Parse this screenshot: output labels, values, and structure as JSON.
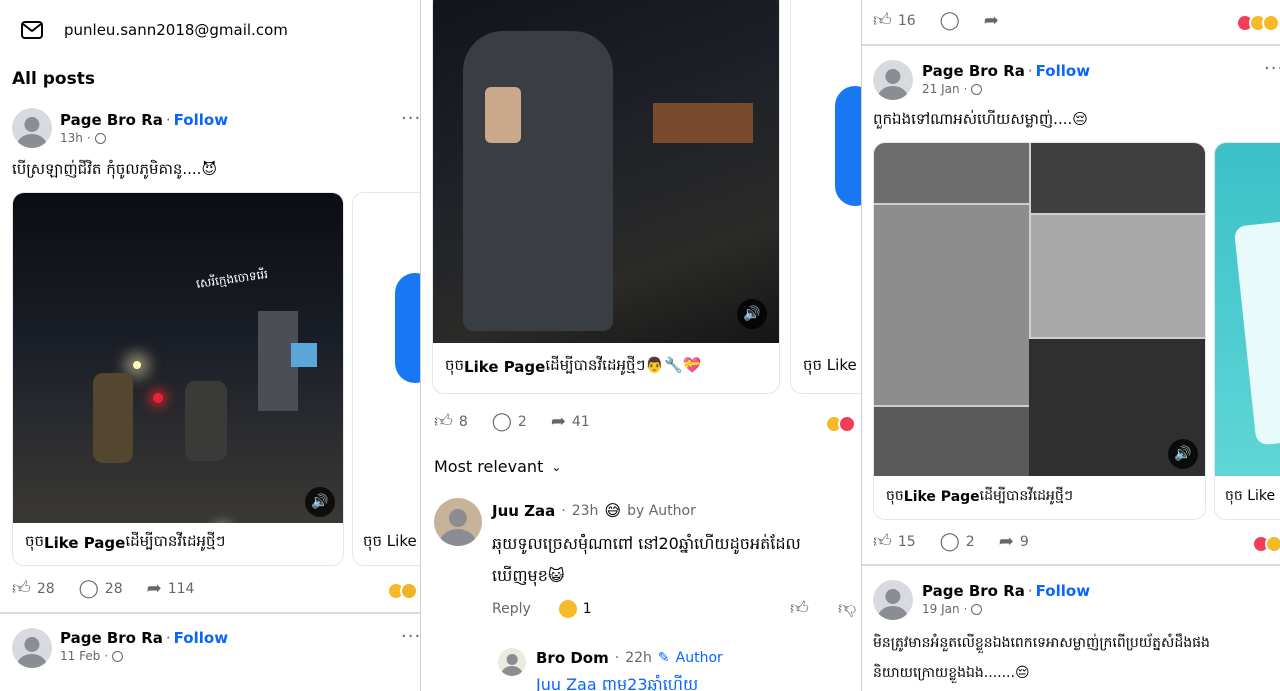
{
  "panel1": {
    "email": "punleu.sann2018@gmail.com",
    "section_title": "All posts",
    "post1": {
      "page_name": "Page Bro Ra",
      "follow": "Follow",
      "time": "13h",
      "caption": "បើស្រឡាញ់ជីវិត កុំចូលភូមិគានូ....😈",
      "video_overlay_text": "សេរីក្មេងចោទរើរ",
      "cta_prefix": "ចុច ",
      "cta_bold": "Like Page",
      "cta_suffix": " ដើម្បីបានវីដេអូថ្មីៗ",
      "cta_partial": "ចុច Like",
      "likes": "28",
      "comments": "28",
      "shares": "114"
    },
    "post2": {
      "page_name": "Page Bro Ra",
      "follow": "Follow",
      "time": "11 Feb"
    }
  },
  "panel2": {
    "cta_prefix": "ចុច ",
    "cta_bold": "Like Page",
    "cta_suffix": " ដើម្បីបានវីដេអូថ្មីៗ👨‍🔧💝",
    "cta_partial": "ចុច Like",
    "likes": "8",
    "comments": "2",
    "shares": "41",
    "sort_label": "Most relevant",
    "comment1": {
      "name": "Juu Zaa",
      "time": "23h",
      "badge": "😅",
      "author_tag": "by Author",
      "text_line1": "ឆុយទូលច្រេសម៉ុំណាពៅ នៅ20ឆ្នាំហើយដូចអត់ដែល",
      "text_line2": "ឃើញមុខ😺",
      "reply": "Reply",
      "reaction_count": "1"
    },
    "reply1": {
      "name": "Bro Dom",
      "time": "22h",
      "author_tag": "Author",
      "text": "Juu Zaa ពាម23ឆ្នាំហើយ"
    }
  },
  "panel3": {
    "top_likes": "16",
    "post1": {
      "page_name": "Page Bro Ra",
      "follow": "Follow",
      "time": "21 Jan",
      "caption": "ពួកឯងទៅណាអស់ហើយសម្លាញ់....😔",
      "cta_prefix": "ចុច ",
      "cta_bold": "Like Page",
      "cta_suffix": " ដើម្បីបានវីដេអូថ្មីៗ",
      "cta_partial": "ចុច Like",
      "likes": "15",
      "comments": "2",
      "shares": "9"
    },
    "post2": {
      "page_name": "Page Bro Ra",
      "follow": "Follow",
      "time": "19 Jan",
      "caption_line1": "មិនត្រូវមានអំនួតលើខ្លួនឯងពេកទេអាសម្លាញ់ក្រពើប្រយ័ត្នសំដឹងផង",
      "caption_line2": "និយាយក្រោយខ្លួងឯង.......😔"
    }
  },
  "icons": {
    "mail": "mail-icon",
    "like": "thumbs-up-icon",
    "comment": "comment-icon",
    "share": "share-icon",
    "globe": "globe-icon",
    "volume": "volume-icon",
    "chevron": "chevron-down-icon",
    "pencil": "pencil-icon",
    "more": "more-dots-icon"
  },
  "colors": {
    "accent": "#0866ff",
    "muted": "#65676b"
  }
}
